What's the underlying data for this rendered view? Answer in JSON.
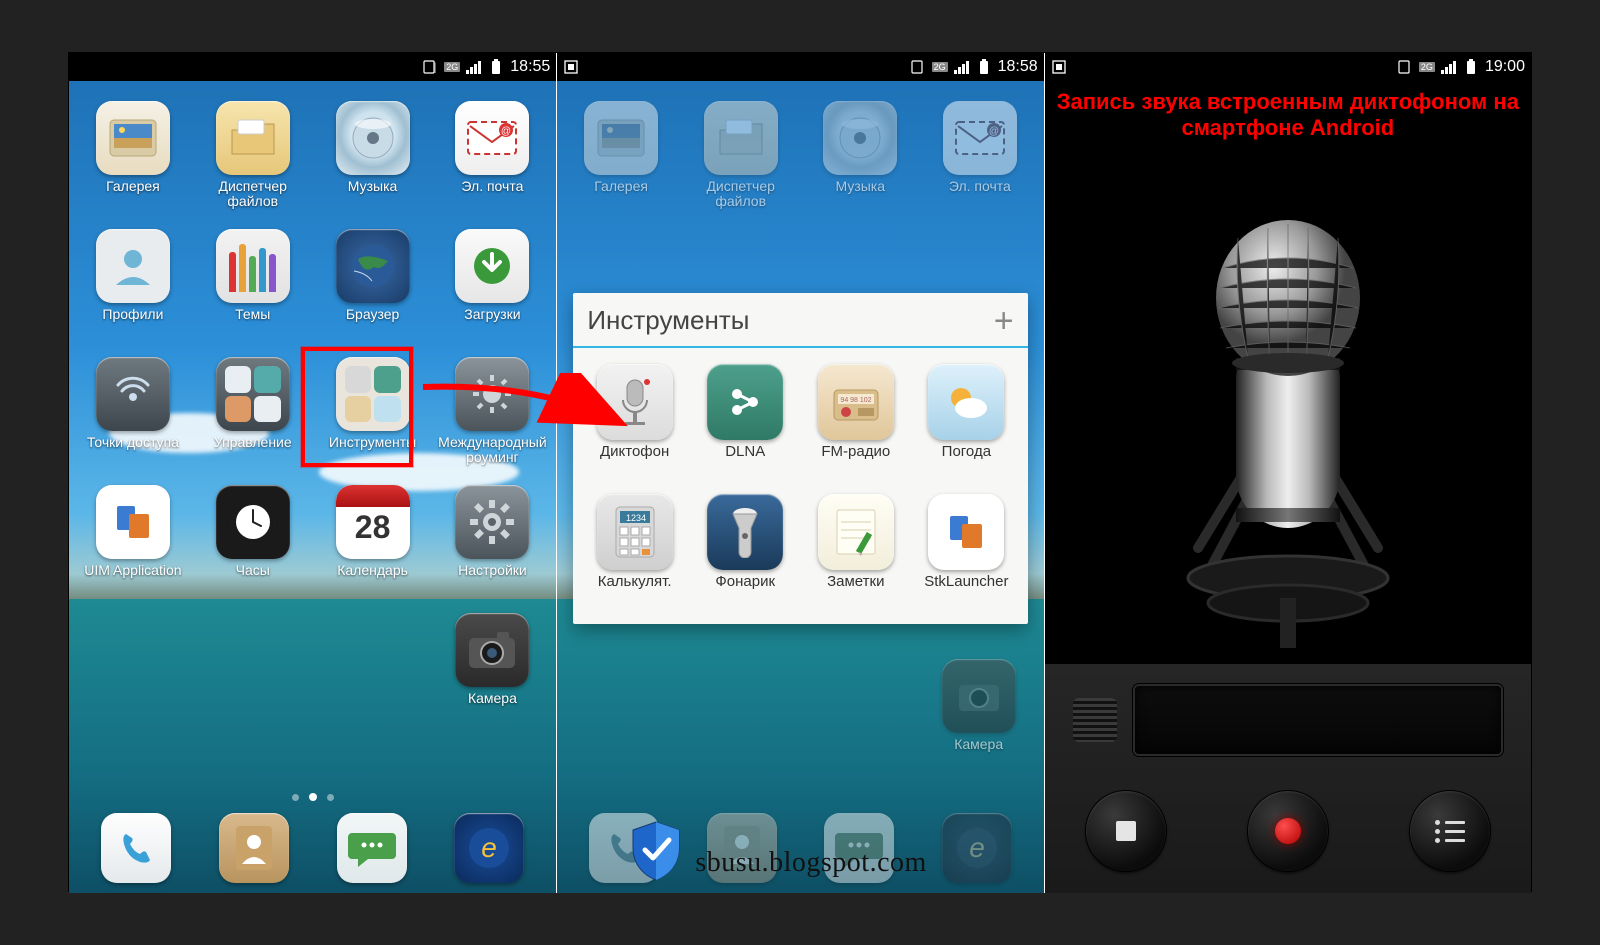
{
  "status": {
    "net_badge": "2G",
    "times": [
      "18:55",
      "18:58",
      "19:00"
    ]
  },
  "screen1": {
    "apps": [
      {
        "name": "gallery",
        "label": "Галерея"
      },
      {
        "name": "files",
        "label": "Диспетчер файлов"
      },
      {
        "name": "music",
        "label": "Музыка"
      },
      {
        "name": "mail",
        "label": "Эл. почта"
      },
      {
        "name": "profiles",
        "label": "Профили"
      },
      {
        "name": "themes",
        "label": "Темы"
      },
      {
        "name": "browser",
        "label": "Браузер"
      },
      {
        "name": "downloads",
        "label": "Загрузки"
      },
      {
        "name": "hotspot",
        "label": "Точки доступа"
      },
      {
        "name": "manage",
        "label": "Управление"
      },
      {
        "name": "tools",
        "label": "Инструменты"
      },
      {
        "name": "roaming",
        "label": "Международный роуминг"
      },
      {
        "name": "uim",
        "label": "UIM Application"
      },
      {
        "name": "clock",
        "label": "Часы"
      },
      {
        "name": "calendar",
        "label": "Календарь"
      },
      {
        "name": "settings",
        "label": "Настройки"
      },
      {
        "name": "blank",
        "label": ""
      },
      {
        "name": "blank",
        "label": ""
      },
      {
        "name": "blank",
        "label": ""
      },
      {
        "name": "camera",
        "label": "Камера"
      }
    ],
    "calendar_day": "28",
    "highlight_index": 10
  },
  "dock": [
    {
      "name": "phone"
    },
    {
      "name": "contacts"
    },
    {
      "name": "messages"
    },
    {
      "name": "browser-e"
    }
  ],
  "screen2": {
    "back_apps": [
      {
        "name": "gallery",
        "label": "Галерея"
      },
      {
        "name": "files",
        "label": "Диспетчер файлов"
      },
      {
        "name": "music",
        "label": "Музыка"
      },
      {
        "name": "mail",
        "label": "Эл. почта"
      }
    ],
    "folder_title": "Инструменты",
    "folder_apps": [
      {
        "name": "recorder",
        "label": "Диктофон"
      },
      {
        "name": "dlna",
        "label": "DLNA"
      },
      {
        "name": "fmradio",
        "label": "FM-радио"
      },
      {
        "name": "weather",
        "label": "Погода"
      },
      {
        "name": "calc",
        "label": "Калькулят."
      },
      {
        "name": "torch",
        "label": "Фонарик"
      },
      {
        "name": "notes",
        "label": "Заметки"
      },
      {
        "name": "stk",
        "label": "StkLauncher"
      }
    ],
    "camera_label": "Камера"
  },
  "screen3": {
    "title": "Запись звука встроенным диктофоном на смартфоне Android"
  },
  "watermark": "sbusu.blogspot.com"
}
